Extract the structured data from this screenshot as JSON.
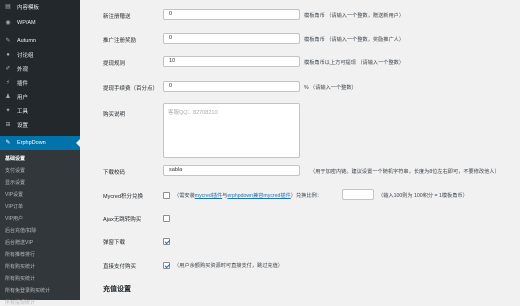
{
  "sidebar": {
    "items": [
      {
        "label": "内容模板",
        "icon": "layout-icon"
      },
      {
        "label": "WP/AM",
        "icon": "wp-icon"
      },
      {
        "label": "Autumn",
        "icon": "autumn-icon"
      },
      {
        "label": "讨论组",
        "icon": "group-icon"
      },
      {
        "label": "外观",
        "icon": "brush-icon"
      },
      {
        "label": "插件",
        "icon": "plugin-icon"
      },
      {
        "label": "用户",
        "icon": "user-icon"
      },
      {
        "label": "工具",
        "icon": "wrench-icon"
      },
      {
        "label": "设置",
        "icon": "settings-icon"
      },
      {
        "label": "ErphpDown",
        "icon": "erphpdown-icon"
      }
    ],
    "submenu": [
      "基础设置",
      "支付设置",
      "显示设置",
      "VIP设置",
      "VIP订单",
      "VIP用户",
      "后台充值/扣除",
      "后台赠送VIP",
      "所有推荐排行",
      "所有购买统计",
      "所有购买统计",
      "所有免登录购买统计",
      "所有提现统计"
    ]
  },
  "form": {
    "new_user_gift": {
      "label": "新注册赠送",
      "value": "0",
      "desc": "模板角币 （请输入一个整数，赠送新用户）"
    },
    "referral_reward": {
      "label": "推广注册奖励",
      "value": "0",
      "desc": "模板角币 （请输入一个整数，奖励推广人）"
    },
    "withdraw_min": {
      "label": "提现规则",
      "value": "10",
      "desc": "模板角币以上方可提现 （请输入一个整数）"
    },
    "withdraw_fee": {
      "label": "提现手续费（百分点）",
      "value": "0",
      "desc": "% （请输入一个整数）"
    },
    "purchase_note": {
      "label": "购买说明",
      "placeholder": "客服QQ：82708210"
    },
    "download_code": {
      "label": "下载校码",
      "value": "sabla",
      "desc": "（用于加密内链。建议设置一个随机字符串，长度为8位左右即可，不要修改他人）"
    },
    "mycred": {
      "label": "Mycred积分兑换",
      "desc_prefix": "（需安装",
      "link1": "mycred插件",
      "desc_mid": "与",
      "link2": "erphpdown兼容mycred插件",
      "desc_suffix": "）兑换比例：",
      "ratio_placeholder": "",
      "ratio_desc": "（输入100则为 100积分 = 1模板角币）",
      "checked": false
    },
    "ajax_buy": {
      "label": "Ajax无跳转购买",
      "checked": false
    },
    "popup_download": {
      "label": "弹窗下载",
      "checked": true
    },
    "direct_pay": {
      "label": "直接支付购买",
      "checked": true,
      "desc": "（用户余额购买资源时可直接支付，跳过充值）"
    }
  },
  "section": {
    "title": "充值设置"
  },
  "colors": {
    "sidebar_bg": "#23282d",
    "active": "#0073aa",
    "link": "#2271b1"
  }
}
